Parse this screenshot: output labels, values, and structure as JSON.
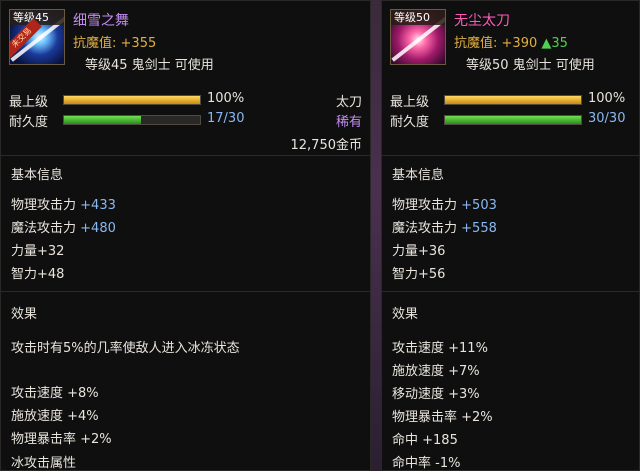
{
  "left": {
    "icon_level": "等级45",
    "icon_ribbon": "未交易",
    "name": "细雪之舞",
    "resist_label": "抗魔值:",
    "resist_value": "+355",
    "requirement": "等级45 鬼剑士 可使用",
    "stats": [
      {
        "label": "最上级",
        "text": "100%",
        "fill": 1.0
      },
      {
        "label": "耐久度",
        "text": "17/30",
        "fill": 0.567
      }
    ],
    "weapon_type": "太刀",
    "rarity": "稀有",
    "price": "12,750金币",
    "basic_title": "基本信息",
    "basic": [
      {
        "label": "物理攻击力",
        "value": "+433"
      },
      {
        "label": "魔法攻击力",
        "value": "+480"
      },
      {
        "label": "力量+32",
        "value": ""
      },
      {
        "label": "智力+48",
        "value": ""
      }
    ],
    "effect_title": "效果",
    "effect_desc": "攻击时有5%的几率使敌人进入冰冻状态",
    "effects": [
      "攻击速度 +8%",
      "施放速度 +4%",
      "物理暴击率 +2%",
      "冰攻击属性"
    ]
  },
  "right": {
    "icon_level": "等级50",
    "name": "无尘太刀",
    "resist_label": "抗魔值:",
    "resist_value": "+390",
    "resist_up": "▲35",
    "requirement": "等级50 鬼剑士 可使用",
    "stats": [
      {
        "label": "最上级",
        "text": "100%",
        "fill": 1.0
      },
      {
        "label": "耐久度",
        "text": "30/30",
        "fill": 1.0
      }
    ],
    "basic_title": "基本信息",
    "basic": [
      {
        "label": "物理攻击力",
        "value": "+503"
      },
      {
        "label": "魔法攻击力",
        "value": "+558"
      },
      {
        "label": "力量+36",
        "value": ""
      },
      {
        "label": "智力+56",
        "value": ""
      }
    ],
    "effect_title": "效果",
    "effects": [
      "攻击速度 +11%",
      "施放速度 +7%",
      "移动速度 +3%",
      "物理暴击率 +2%",
      "命中 +185",
      "命中率 -1%"
    ]
  },
  "colors": {
    "name_left": "#c48cf0",
    "name_right": "#ff5ab8",
    "gold": "#e0b040",
    "stat_blue": "#8ab8f0",
    "up_green": "#50d050"
  }
}
